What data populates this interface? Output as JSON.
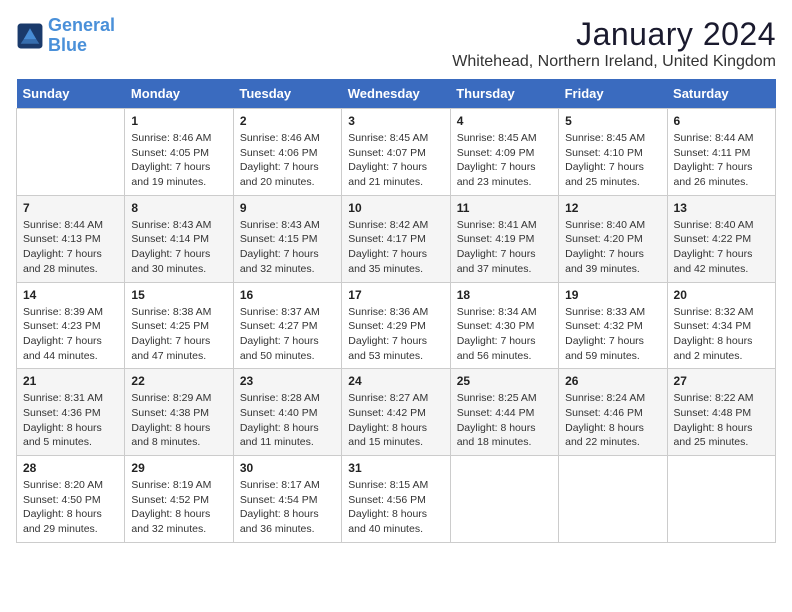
{
  "logo": {
    "text_general": "General",
    "text_blue": "Blue"
  },
  "title": "January 2024",
  "location": "Whitehead, Northern Ireland, United Kingdom",
  "days_of_week": [
    "Sunday",
    "Monday",
    "Tuesday",
    "Wednesday",
    "Thursday",
    "Friday",
    "Saturday"
  ],
  "weeks": [
    [
      {
        "day": "",
        "sunrise": "",
        "sunset": "",
        "daylight": ""
      },
      {
        "day": "1",
        "sunrise": "Sunrise: 8:46 AM",
        "sunset": "Sunset: 4:05 PM",
        "daylight": "Daylight: 7 hours and 19 minutes."
      },
      {
        "day": "2",
        "sunrise": "Sunrise: 8:46 AM",
        "sunset": "Sunset: 4:06 PM",
        "daylight": "Daylight: 7 hours and 20 minutes."
      },
      {
        "day": "3",
        "sunrise": "Sunrise: 8:45 AM",
        "sunset": "Sunset: 4:07 PM",
        "daylight": "Daylight: 7 hours and 21 minutes."
      },
      {
        "day": "4",
        "sunrise": "Sunrise: 8:45 AM",
        "sunset": "Sunset: 4:09 PM",
        "daylight": "Daylight: 7 hours and 23 minutes."
      },
      {
        "day": "5",
        "sunrise": "Sunrise: 8:45 AM",
        "sunset": "Sunset: 4:10 PM",
        "daylight": "Daylight: 7 hours and 25 minutes."
      },
      {
        "day": "6",
        "sunrise": "Sunrise: 8:44 AM",
        "sunset": "Sunset: 4:11 PM",
        "daylight": "Daylight: 7 hours and 26 minutes."
      }
    ],
    [
      {
        "day": "7",
        "sunrise": "Sunrise: 8:44 AM",
        "sunset": "Sunset: 4:13 PM",
        "daylight": "Daylight: 7 hours and 28 minutes."
      },
      {
        "day": "8",
        "sunrise": "Sunrise: 8:43 AM",
        "sunset": "Sunset: 4:14 PM",
        "daylight": "Daylight: 7 hours and 30 minutes."
      },
      {
        "day": "9",
        "sunrise": "Sunrise: 8:43 AM",
        "sunset": "Sunset: 4:15 PM",
        "daylight": "Daylight: 7 hours and 32 minutes."
      },
      {
        "day": "10",
        "sunrise": "Sunrise: 8:42 AM",
        "sunset": "Sunset: 4:17 PM",
        "daylight": "Daylight: 7 hours and 35 minutes."
      },
      {
        "day": "11",
        "sunrise": "Sunrise: 8:41 AM",
        "sunset": "Sunset: 4:19 PM",
        "daylight": "Daylight: 7 hours and 37 minutes."
      },
      {
        "day": "12",
        "sunrise": "Sunrise: 8:40 AM",
        "sunset": "Sunset: 4:20 PM",
        "daylight": "Daylight: 7 hours and 39 minutes."
      },
      {
        "day": "13",
        "sunrise": "Sunrise: 8:40 AM",
        "sunset": "Sunset: 4:22 PM",
        "daylight": "Daylight: 7 hours and 42 minutes."
      }
    ],
    [
      {
        "day": "14",
        "sunrise": "Sunrise: 8:39 AM",
        "sunset": "Sunset: 4:23 PM",
        "daylight": "Daylight: 7 hours and 44 minutes."
      },
      {
        "day": "15",
        "sunrise": "Sunrise: 8:38 AM",
        "sunset": "Sunset: 4:25 PM",
        "daylight": "Daylight: 7 hours and 47 minutes."
      },
      {
        "day": "16",
        "sunrise": "Sunrise: 8:37 AM",
        "sunset": "Sunset: 4:27 PM",
        "daylight": "Daylight: 7 hours and 50 minutes."
      },
      {
        "day": "17",
        "sunrise": "Sunrise: 8:36 AM",
        "sunset": "Sunset: 4:29 PM",
        "daylight": "Daylight: 7 hours and 53 minutes."
      },
      {
        "day": "18",
        "sunrise": "Sunrise: 8:34 AM",
        "sunset": "Sunset: 4:30 PM",
        "daylight": "Daylight: 7 hours and 56 minutes."
      },
      {
        "day": "19",
        "sunrise": "Sunrise: 8:33 AM",
        "sunset": "Sunset: 4:32 PM",
        "daylight": "Daylight: 7 hours and 59 minutes."
      },
      {
        "day": "20",
        "sunrise": "Sunrise: 8:32 AM",
        "sunset": "Sunset: 4:34 PM",
        "daylight": "Daylight: 8 hours and 2 minutes."
      }
    ],
    [
      {
        "day": "21",
        "sunrise": "Sunrise: 8:31 AM",
        "sunset": "Sunset: 4:36 PM",
        "daylight": "Daylight: 8 hours and 5 minutes."
      },
      {
        "day": "22",
        "sunrise": "Sunrise: 8:29 AM",
        "sunset": "Sunset: 4:38 PM",
        "daylight": "Daylight: 8 hours and 8 minutes."
      },
      {
        "day": "23",
        "sunrise": "Sunrise: 8:28 AM",
        "sunset": "Sunset: 4:40 PM",
        "daylight": "Daylight: 8 hours and 11 minutes."
      },
      {
        "day": "24",
        "sunrise": "Sunrise: 8:27 AM",
        "sunset": "Sunset: 4:42 PM",
        "daylight": "Daylight: 8 hours and 15 minutes."
      },
      {
        "day": "25",
        "sunrise": "Sunrise: 8:25 AM",
        "sunset": "Sunset: 4:44 PM",
        "daylight": "Daylight: 8 hours and 18 minutes."
      },
      {
        "day": "26",
        "sunrise": "Sunrise: 8:24 AM",
        "sunset": "Sunset: 4:46 PM",
        "daylight": "Daylight: 8 hours and 22 minutes."
      },
      {
        "day": "27",
        "sunrise": "Sunrise: 8:22 AM",
        "sunset": "Sunset: 4:48 PM",
        "daylight": "Daylight: 8 hours and 25 minutes."
      }
    ],
    [
      {
        "day": "28",
        "sunrise": "Sunrise: 8:20 AM",
        "sunset": "Sunset: 4:50 PM",
        "daylight": "Daylight: 8 hours and 29 minutes."
      },
      {
        "day": "29",
        "sunrise": "Sunrise: 8:19 AM",
        "sunset": "Sunset: 4:52 PM",
        "daylight": "Daylight: 8 hours and 32 minutes."
      },
      {
        "day": "30",
        "sunrise": "Sunrise: 8:17 AM",
        "sunset": "Sunset: 4:54 PM",
        "daylight": "Daylight: 8 hours and 36 minutes."
      },
      {
        "day": "31",
        "sunrise": "Sunrise: 8:15 AM",
        "sunset": "Sunset: 4:56 PM",
        "daylight": "Daylight: 8 hours and 40 minutes."
      },
      {
        "day": "",
        "sunrise": "",
        "sunset": "",
        "daylight": ""
      },
      {
        "day": "",
        "sunrise": "",
        "sunset": "",
        "daylight": ""
      },
      {
        "day": "",
        "sunrise": "",
        "sunset": "",
        "daylight": ""
      }
    ]
  ]
}
